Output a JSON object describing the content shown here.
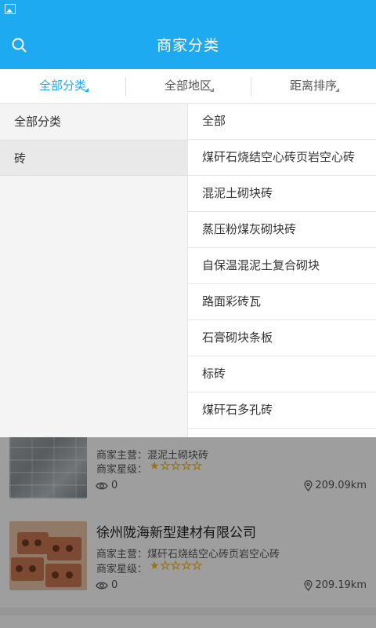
{
  "app_bar": {
    "title": "商家分类"
  },
  "filters": [
    {
      "label": "全部分类"
    },
    {
      "label": "全部地区"
    },
    {
      "label": "距离排序"
    }
  ],
  "categories_left": [
    {
      "label": "全部分类"
    },
    {
      "label": "砖"
    }
  ],
  "categories_right": [
    {
      "label": "全部"
    },
    {
      "label": "煤矸石烧结空心砖页岩空心砖"
    },
    {
      "label": "混泥土砌块砖"
    },
    {
      "label": "蒸压粉煤灰砌块砖"
    },
    {
      "label": "自保温混泥土复合砌块"
    },
    {
      "label": "路面彩砖瓦"
    },
    {
      "label": "石膏砌块条板"
    },
    {
      "label": "标砖"
    },
    {
      "label": "煤矸石多孔砖"
    }
  ],
  "merchants": [
    {
      "main_business": "商家主营：混泥土砌块砖",
      "rating_label": "商家星级：",
      "rating": 1,
      "rating_max": 5,
      "views": "0",
      "distance": "209.09km"
    },
    {
      "name": "徐州陇海新型建材有限公司",
      "main_business": "商家主营：煤矸石烧结空心砖页岩空心砖",
      "rating_label": "商家星级：",
      "rating": 1,
      "rating_max": 5,
      "views": "0",
      "distance": "209.19km"
    }
  ],
  "colors": {
    "accent": "#1eaaf1",
    "star": "#f2b81d"
  }
}
